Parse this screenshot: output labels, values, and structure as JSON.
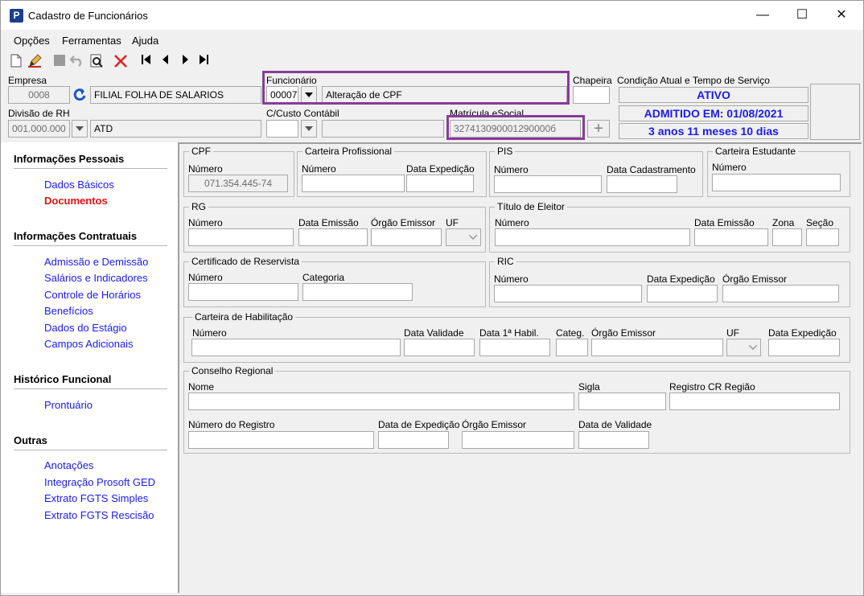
{
  "window": {
    "title": "Cadastro de Funcionários",
    "app_icon": "P"
  },
  "menu": {
    "opcoes": "Opções",
    "ferramentas": "Ferramentas",
    "ajuda": "Ajuda"
  },
  "header": {
    "empresa_label": "Empresa",
    "empresa_code": "0008",
    "empresa_name": "FILIAL FOLHA DE SALARIOS",
    "funcionario_label": "Funcionário",
    "funcionario_code": "00007",
    "funcionario_name": "Alteração de CPF",
    "chapeira_label": "Chapeira",
    "chapeira_value": "",
    "condicao_label": "Condição Atual e Tempo de Serviço",
    "status_ativo": "ATIVO",
    "status_admitido": "ADMITIDO EM: 01/08/2021",
    "status_tempo": "3 anos 11 meses 10 dias",
    "divisao_label": "Divisão de RH",
    "divisao_code": "001.000.000",
    "divisao_name": "ATD",
    "ccusto_label": "C/Custo Contábil",
    "matricula_label": "Matrícula eSocial",
    "matricula_value": "327413090001290000б"
  },
  "nav": {
    "pessoais_title": "Informações Pessoais",
    "dados_basicos": "Dados Básicos",
    "documentos": "Documentos",
    "contratuais_title": "Informações Contratuais",
    "admissao": "Admissão e Demissão",
    "salarios": "Salários e Indicadores",
    "horarios": "Controle de Horários",
    "beneficios": "Benefícios",
    "estagio": "Dados do Estágio",
    "campos": "Campos Adicionais",
    "historico_title": "Histórico Funcional",
    "prontuario": "Prontuário",
    "outras_title": "Outras",
    "anotacoes": "Anotações",
    "integracao": "Integração Prosoft GED",
    "fgts_simples": "Extrato FGTS Simples",
    "fgts_rescisao": "Extrato FGTS Rescisão"
  },
  "docs": {
    "cpf": {
      "title": "CPF",
      "numero_label": "Número",
      "numero_value": "071.354.445-74"
    },
    "ctps": {
      "title": "Carteira Profissional",
      "numero_label": "Número",
      "data_label": "Data Expedição"
    },
    "pis": {
      "title": "PIS",
      "numero_label": "Número",
      "data_label": "Data Cadastramento"
    },
    "estudante": {
      "title": "Carteira Estudante",
      "numero_label": "Número"
    },
    "rg": {
      "title": "RG",
      "numero_label": "Número",
      "data_label": "Data Emissão",
      "orgao_label": "Órgão Emissor",
      "uf_label": "UF"
    },
    "titulo": {
      "title": "Título de Eleitor",
      "numero_label": "Número",
      "data_label": "Data Emissão",
      "zona_label": "Zona",
      "secao_label": "Seção"
    },
    "reservista": {
      "title": "Certificado de Reservista",
      "numero_label": "Número",
      "categoria_label": "Categoria"
    },
    "ric": {
      "title": "RIC",
      "numero_label": "Número",
      "data_label": "Data Expedição",
      "orgao_label": "Órgão Emissor"
    },
    "cnh": {
      "title": "Carteira de Habilitação",
      "numero_label": "Número",
      "validade_label": "Data Validade",
      "habil_label": "Data 1ª Habil.",
      "categ_label": "Categ.",
      "orgao_label": "Órgão Emissor",
      "uf_label": "UF",
      "expedicao_label": "Data Expedição"
    },
    "conselho": {
      "title": "Conselho Regional",
      "nome_label": "Nome",
      "sigla_label": "Sigla",
      "registro_cr_label": "Registro CR Região",
      "num_registro_label": "Número do Registro",
      "expedicao_label": "Data de Expedição",
      "orgao_label": "Órgão Emissor",
      "validade_label": "Data de Validade"
    }
  }
}
